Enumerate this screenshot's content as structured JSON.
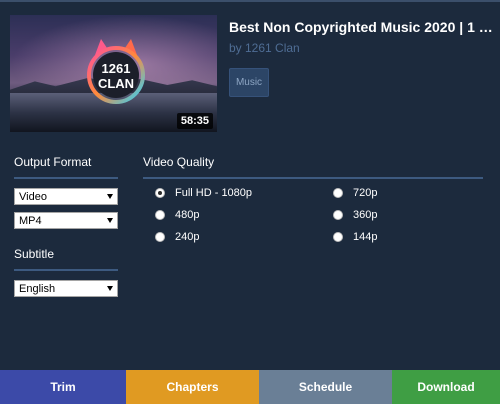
{
  "video": {
    "title": "Best Non Copyrighted Music 2020 | 1 Hour C...",
    "channel": "by 1261 Clan",
    "tag": "Music",
    "duration": "58:35",
    "thumbnail_logo_lines": [
      "1261",
      "CLAN"
    ]
  },
  "left": {
    "output_format_label": "Output Format",
    "format_value": "Video",
    "container_value": "MP4",
    "subtitle_label": "Subtitle",
    "subtitle_value": "English"
  },
  "quality": {
    "label": "Video Quality",
    "options": [
      "Full HD - 1080p",
      "720p",
      "480p",
      "360p",
      "240p",
      "144p"
    ],
    "selected": "Full HD - 1080p"
  },
  "bottom": {
    "trim": "Trim",
    "chapters": "Chapters",
    "schedule": "Schedule",
    "download": "Download"
  },
  "colors": {
    "background": "#1c2a3d",
    "accent_rule": "#3d5a80",
    "trim": "#3c4aa8",
    "chapters": "#e09a22",
    "schedule": "#6a7f96",
    "download": "#3f9e44"
  }
}
